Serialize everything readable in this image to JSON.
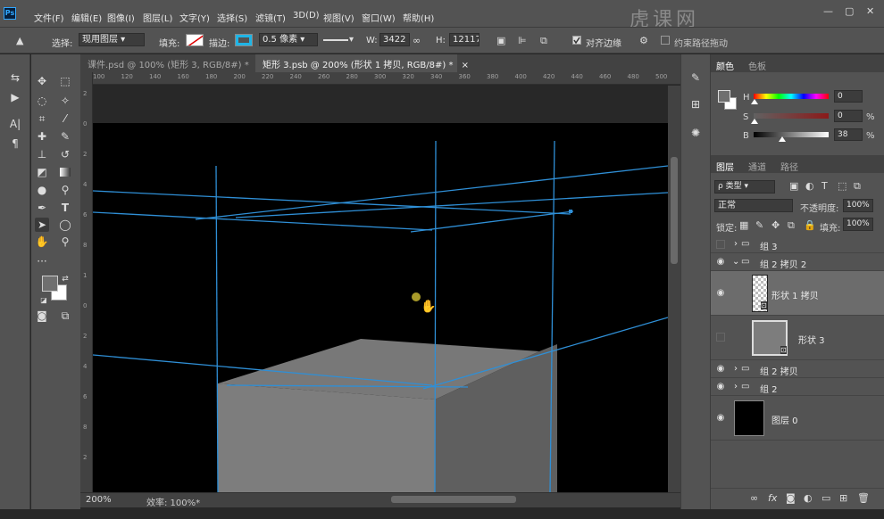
{
  "menubar": {
    "app_icon": "Ps",
    "items": [
      "文件(F)",
      "编辑(E)",
      "图像(I)",
      "图层(L)",
      "文字(Y)",
      "选择(S)",
      "滤镜(T)",
      "3D(D)",
      "视图(V)",
      "窗口(W)",
      "帮助(H)"
    ],
    "window_controls": {
      "minimize": "—",
      "maximize": "▢",
      "close": "✕"
    }
  },
  "watermark": "虎课网",
  "options": {
    "select_label": "选择:",
    "select_value": "现用图层",
    "fill_label": "填充:",
    "stroke_label": "描边:",
    "stroke_width": "0.5 像素",
    "w_label": "W:",
    "w_value": "3422 像",
    "h_label": "H:",
    "h_value": "12117",
    "align_edges": "对齐边缘",
    "constrain_path": "约束路径拖动",
    "accent": "#1fb5e6"
  },
  "tabs": [
    {
      "label": "课件.psd @ 100% (矩形 3, RGB/8#) *",
      "close": "×"
    },
    {
      "label": "矩形 3.psb @ 200% (形状 1 拷贝, RGB/8#) *",
      "close": "×"
    }
  ],
  "ruler_h": [
    "100",
    "120",
    "140",
    "160",
    "180",
    "200",
    "220",
    "240",
    "260",
    "280",
    "300",
    "320",
    "340",
    "360",
    "380",
    "400",
    "420",
    "440",
    "460",
    "480",
    "500"
  ],
  "ruler_v": [
    "2",
    "0",
    "2",
    "4",
    "6",
    "8",
    "1",
    "0",
    "2",
    "4",
    "6",
    "8",
    "2"
  ],
  "status": {
    "zoom": "200%",
    "efficiency": "效率: 100%*"
  },
  "color_panel": {
    "tabs": [
      "颜色",
      "色板"
    ],
    "h_label": "H",
    "h_value": "0",
    "h_unit": "",
    "s_label": "S",
    "s_value": "0",
    "s_unit": "%",
    "b_label": "B",
    "b_value": "38",
    "b_unit": "%"
  },
  "layers_panel": {
    "tabs": [
      "图层",
      "通道",
      "路径"
    ],
    "filter_label": "ρ 类型",
    "blend_mode": "正常",
    "opacity_label": "不透明度:",
    "opacity_value": "100%",
    "lock_label": "锁定:",
    "fill_label": "填充:",
    "fill_value": "100%",
    "layers": [
      {
        "name": "组 3",
        "kind": "group",
        "visible": false,
        "expanded": false
      },
      {
        "name": "组 2 拷贝 2",
        "kind": "group",
        "visible": true,
        "expanded": true
      },
      {
        "name": "形状 1 拷贝",
        "kind": "shape",
        "visible": true,
        "selected": true
      },
      {
        "name": "形状 3",
        "kind": "shape",
        "visible": false
      },
      {
        "name": "组 2 拷贝",
        "kind": "group",
        "visible": true,
        "expanded": false
      },
      {
        "name": "组 2",
        "kind": "group",
        "visible": true,
        "expanded": false
      },
      {
        "name": "图层 0",
        "kind": "pixel",
        "visible": true
      }
    ],
    "footer_icons": [
      "link-icon",
      "fx-icon",
      "mask-icon",
      "adjustment-icon",
      "folder-icon",
      "new-layer-icon",
      "trash-icon"
    ]
  },
  "colors": {
    "ui_bg": "#535353",
    "canvas_black": "#000000",
    "path_blue": "#2f8fd6",
    "box_light": "#7d7d7d",
    "box_dark": "#6b6b6b",
    "box_top": "#787878"
  }
}
